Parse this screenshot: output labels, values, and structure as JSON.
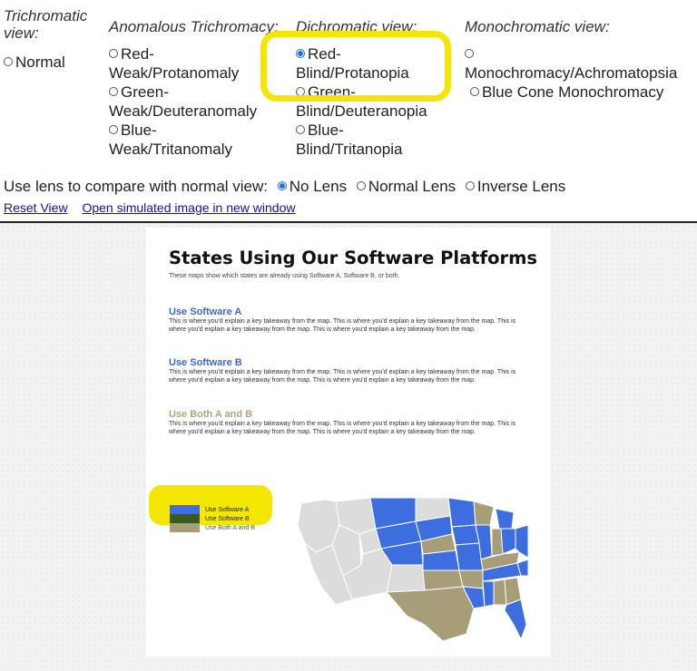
{
  "groups": {
    "trichromatic": {
      "heading": "Trichromatic view:",
      "options": [
        "Normal"
      ]
    },
    "anomalous": {
      "heading": "Anomalous Trichromacy:",
      "options": [
        "Red-Weak/Protanomaly",
        "Green-Weak/Deuteranomaly",
        "Blue-Weak/Tritanomaly"
      ]
    },
    "dichromatic": {
      "heading": "Dichromatic view:",
      "options": [
        "Red-Blind/Protanopia",
        "Green-Blind/Deuteranopia",
        "Blue-Blind/Tritanopia"
      ]
    },
    "monochromatic": {
      "heading": "Monochromatic view:",
      "options": [
        "Monochromacy/Achromatopsia",
        "Blue Cone Monochromacy"
      ]
    }
  },
  "lens": {
    "prompt": "Use lens to compare with normal view:",
    "options": [
      "No Lens",
      "Normal Lens",
      "Inverse Lens"
    ]
  },
  "links": {
    "reset": "Reset View",
    "open": "Open simulated image in new window"
  },
  "poster": {
    "title": "States Using Our Software Platforms",
    "subtitle": "These maps show which states are already using Software A, Software B, or both.",
    "sections": [
      {
        "heading": "Use Software A",
        "color": "#3f67d9",
        "body": "This is where you'd explain a key takeaway from the map. This is where you'd explain a key takeaway from the map. This is where you'd explain a key takeaway from the map. This is where you'd explain a key takeaway from the map."
      },
      {
        "heading": "Use Software B",
        "color": "#3f67d9",
        "body": "This is where you'd explain a key takeaway from the map. This is where you'd explain a key takeaway from the map. This is where you'd explain a key takeaway from the map. This is where you'd explain a key takeaway from the map."
      },
      {
        "heading": "Use Both A and B",
        "color": "#aea57f",
        "body": "This is where you'd explain a key takeaway from the map. This is where you'd explain a key takeaway from the map. This is where you'd explain a key takeaway from the map. This is where you'd explain a key takeaway from the map."
      }
    ],
    "legend": [
      {
        "label": "Use Software A",
        "color": "#3d6ee0"
      },
      {
        "label": "Use Software B",
        "color": "#3d6ee0"
      },
      {
        "label": "Use Both A and B",
        "color": "#a79d78"
      }
    ]
  },
  "colors": {
    "softwareA": "#3d6ee0",
    "both": "#a79d78",
    "none": "#dcdcdc",
    "highlight": "#f3e600"
  }
}
